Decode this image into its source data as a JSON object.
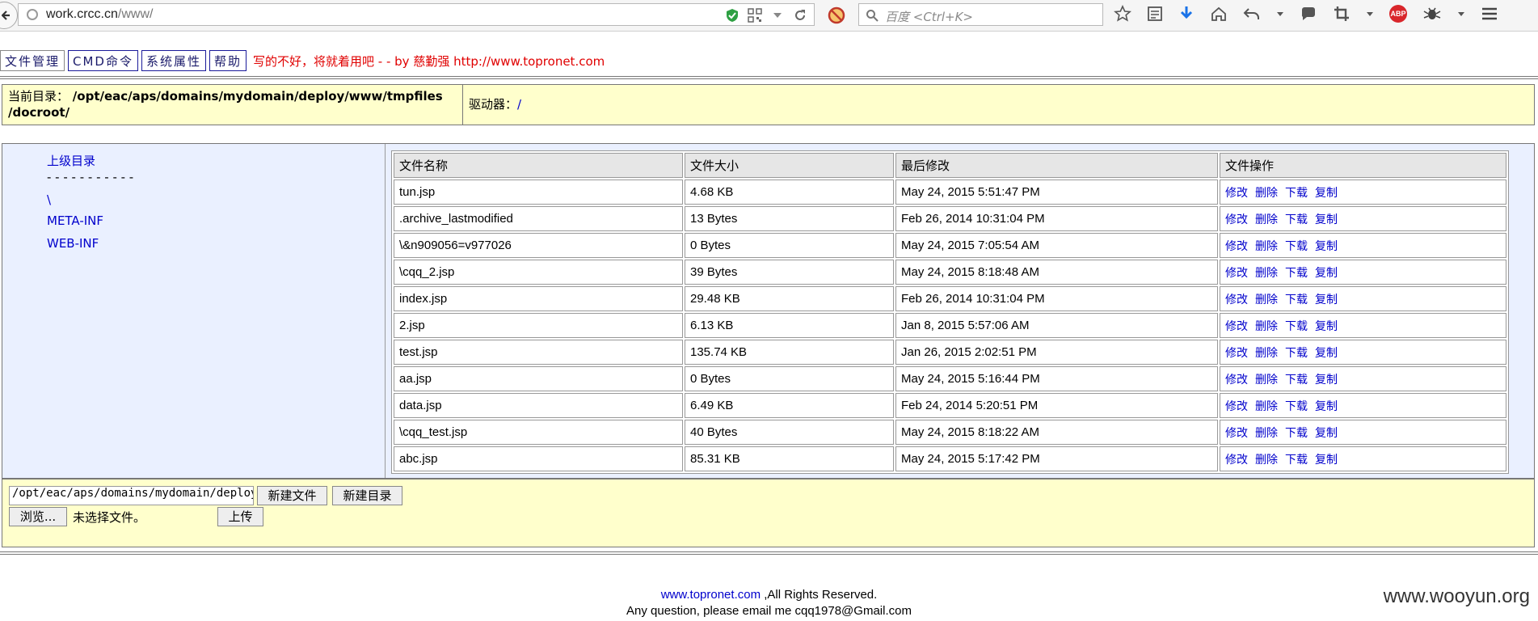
{
  "browser": {
    "url_host": "work.crcc.cn",
    "url_path": "/www/",
    "search_placeholder": "百度 <Ctrl+K>",
    "abp_label": "ABP"
  },
  "menu": {
    "items": [
      "文件管理",
      "CMD命令",
      "系统属性",
      "帮助"
    ],
    "credit": "写的不好，将就着用吧 - - by 慈勤强 http://www.topronet.com"
  },
  "pathbar": {
    "current_label": "当前目录：",
    "current_path": "/opt/eac/aps/domains/mydomain/deploy/www/tmpfiles /docroot/",
    "drives_label": "驱动器：",
    "drives_link": "/"
  },
  "dirpane": {
    "parent_dir": "上级目录",
    "separator": "- - - - - - - - - - -",
    "folders": [
      "\\",
      "META-INF",
      "WEB-INF"
    ]
  },
  "files": {
    "headers": [
      "文件名称",
      "文件大小",
      "最后修改",
      "文件操作"
    ],
    "ops": [
      "修改",
      "删除",
      "下载",
      "复制"
    ],
    "rows": [
      {
        "name": "tun.jsp",
        "size": "4.68 KB",
        "modified": "May 24, 2015 5:51:47 PM"
      },
      {
        "name": ".archive_lastmodified",
        "size": "13 Bytes",
        "modified": "Feb 26, 2014 10:31:04 PM"
      },
      {
        "name": "\\&n909056=v977026",
        "size": "0 Bytes",
        "modified": "May 24, 2015 7:05:54 AM"
      },
      {
        "name": "\\cqq_2.jsp",
        "size": "39 Bytes",
        "modified": "May 24, 2015 8:18:48 AM"
      },
      {
        "name": "index.jsp",
        "size": "29.48 KB",
        "modified": "Feb 26, 2014 10:31:04 PM"
      },
      {
        "name": "2.jsp",
        "size": "6.13 KB",
        "modified": "Jan 8, 2015 5:57:06 AM"
      },
      {
        "name": "test.jsp",
        "size": "135.74 KB",
        "modified": "Jan 26, 2015 2:02:51 PM"
      },
      {
        "name": "aa.jsp",
        "size": "0 Bytes",
        "modified": "May 24, 2015 5:16:44 PM"
      },
      {
        "name": "data.jsp",
        "size": "6.49 KB",
        "modified": "Feb 24, 2014 5:20:51 PM"
      },
      {
        "name": "\\cqq_test.jsp",
        "size": "40 Bytes",
        "modified": "May 24, 2015 8:18:22 AM"
      },
      {
        "name": "abc.jsp",
        "size": "85.31 KB",
        "modified": "May 24, 2015 5:17:42 PM"
      }
    ]
  },
  "bottom": {
    "path_value": "/opt/eac/aps/domains/mydomain/deploy/www/tmpfiles/docroot/",
    "new_file": "新建文件",
    "new_dir": "新建目录",
    "browse": "浏览...",
    "no_file": "未选择文件。",
    "upload": "上传"
  },
  "footer": {
    "link": "www.topronet.com",
    "rights": " ,All Rights Reserved.",
    "contact": "Any question, please email me cqq1978@Gmail.com"
  },
  "watermark": "www.wooyun.org"
}
